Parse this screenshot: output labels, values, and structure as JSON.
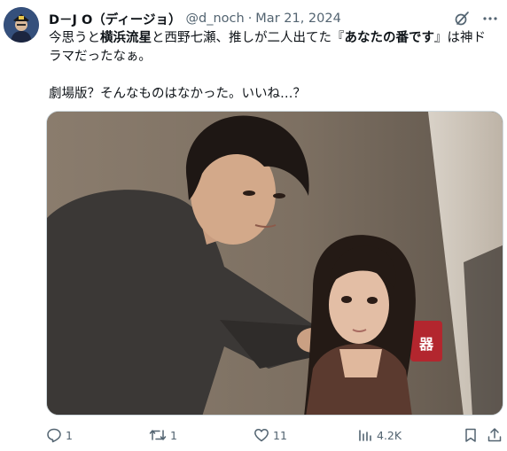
{
  "author": {
    "display_name": "D－J O（ディージョ）",
    "handle": "@d_noch",
    "separator": "·",
    "date": "Mar 21, 2024"
  },
  "body": {
    "line1_pre": "今思うと",
    "line1_bold1": "横浜流星",
    "line1_mid": "と西野七瀬、推しが二人出てた『",
    "line1_bold2": "あなたの番です",
    "line1_post": "』は神ド",
    "line2": "ラマだったなぁ。",
    "line3": "劇場版？そんなものはなかった。いいね…？"
  },
  "media": {
    "sign_text": "器"
  },
  "actions": {
    "replies": "1",
    "reposts": "1",
    "likes": "11",
    "views": "4.2K"
  },
  "icons": {
    "grok": "slash-circle-icon",
    "more": "more-icon",
    "reply": "reply-icon",
    "repost": "repost-icon",
    "like": "heart-icon",
    "views": "views-icon",
    "bookmark": "bookmark-icon",
    "share": "share-icon"
  },
  "colors": {
    "text": "#0f1419",
    "secondary": "#536471",
    "border": "#cfd9de"
  }
}
